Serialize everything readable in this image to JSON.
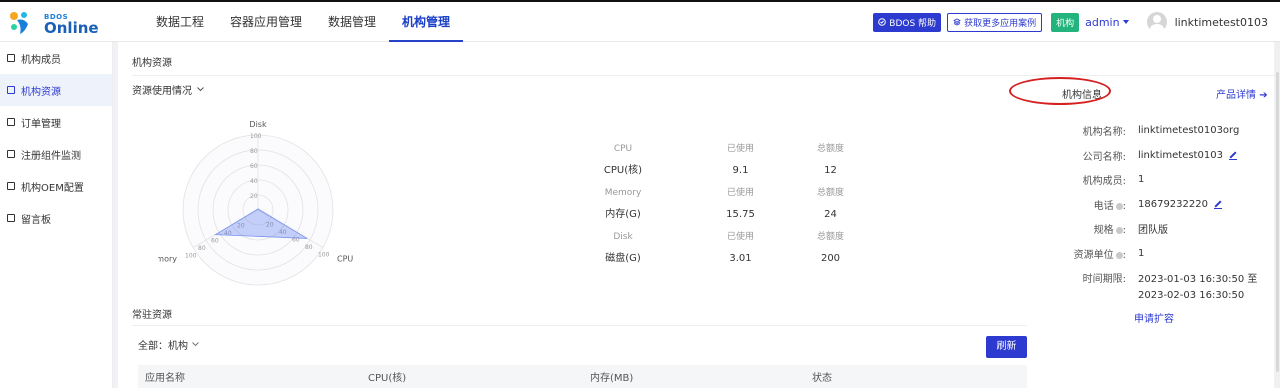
{
  "logo": {
    "sub": "BDOS",
    "main": "Online"
  },
  "nav": {
    "items": [
      {
        "label": "数据工程"
      },
      {
        "label": "容器应用管理"
      },
      {
        "label": "数据管理"
      },
      {
        "label": "机构管理"
      }
    ]
  },
  "header": {
    "help_label": "BDOS 帮助",
    "cases_label": "获取更多应用案例",
    "org_badge": "机构",
    "admin_label": "admin",
    "username": "linktimetest0103"
  },
  "sidebar": {
    "items": [
      {
        "label": "机构成员"
      },
      {
        "label": "机构资源"
      },
      {
        "label": "订单管理"
      },
      {
        "label": "注册组件监测"
      },
      {
        "label": "机构OEM配置"
      },
      {
        "label": "留言板"
      }
    ]
  },
  "main": {
    "page_title": "机构资源",
    "section_title": "资源使用情况",
    "radar": {
      "axes": [
        "Disk",
        "CPU",
        "Memory"
      ],
      "ticks": [
        "20",
        "40",
        "60",
        "80",
        "100"
      ],
      "values": [
        1.5,
        75.8,
        65.6
      ]
    },
    "stats": [
      {
        "category": "CPU",
        "used_label": "已使用",
        "total_label": "总额度",
        "name": "CPU(核)",
        "used": "9.1",
        "total": "12"
      },
      {
        "category": "Memory",
        "used_label": "已使用",
        "total_label": "总额度",
        "name": "内存(G)",
        "used": "15.75",
        "total": "24"
      },
      {
        "category": "Disk",
        "used_label": "已使用",
        "total_label": "总额度",
        "name": "磁盘(G)",
        "used": "3.01",
        "total": "200"
      }
    ],
    "permanent_title": "常驻资源",
    "filter_label": "全部：机构",
    "refresh_label": "刷新",
    "table_headers": [
      "应用名称",
      "CPU(核)",
      "内存(MB)",
      "状态"
    ]
  },
  "info": {
    "title": "机构信息",
    "detail_link": "产品详情",
    "rows": {
      "org_name_label": "机构名称:",
      "org_name": "linktimetest0103org",
      "company_label": "公司名称:",
      "company": "linktimetest0103",
      "members_label": "机构成员:",
      "members": "1",
      "phone_label": "电话",
      "phone": "18679232220",
      "spec_label": "规格",
      "spec": "团队版",
      "unit_label": "资源单位",
      "unit": "1",
      "period_label": "时间期限:",
      "period_start": "2023-01-03 16:30:50 至",
      "period_end": "2023-02-03 16:30:50",
      "apply_label": "申请扩容"
    }
  },
  "colors": {
    "accent": "#2d3acf",
    "badge_green": "#23b37c",
    "highlight_red": "#d42020"
  }
}
